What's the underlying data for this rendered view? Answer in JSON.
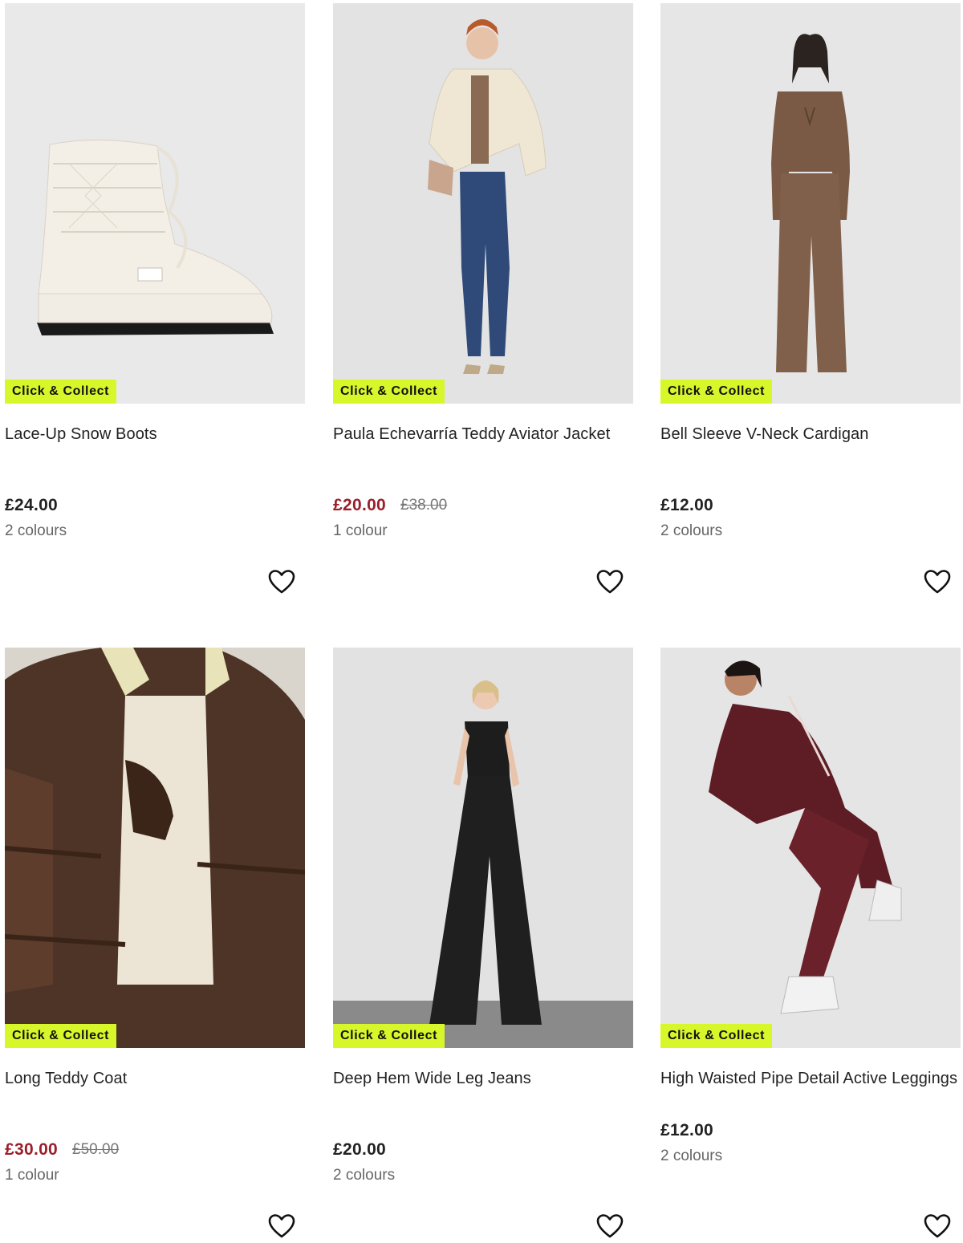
{
  "products": [
    {
      "title": "Lace-Up Snow Boots",
      "badge": "Click & Collect",
      "price": "£24.00",
      "was_price": "",
      "colours": "2 colours"
    },
    {
      "title": "Paula Echevarría Teddy Aviator Jacket",
      "badge": "Click & Collect",
      "price": "£20.00",
      "was_price": "£38.00",
      "colours": "1 colour"
    },
    {
      "title": "Bell Sleeve V-Neck Cardigan",
      "badge": "Click & Collect",
      "price": "£12.00",
      "was_price": "",
      "colours": "2 colours"
    },
    {
      "title": "Long Teddy Coat",
      "badge": "Click & Collect",
      "price": "£30.00",
      "was_price": "£50.00",
      "colours": "1 colour"
    },
    {
      "title": "Deep Hem Wide Leg Jeans",
      "badge": "Click & Collect",
      "price": "£20.00",
      "was_price": "",
      "colours": "2 colours"
    },
    {
      "title": "High Waisted Pipe Detail Active Leggings",
      "badge": "Click & Collect",
      "price": "£12.00",
      "was_price": "",
      "colours": "2 colours"
    }
  ],
  "icons": {
    "favourite": "heart-outline-icon"
  },
  "colors": {
    "badge_bg": "#d7f72a",
    "sale_price": "#9b1f2b",
    "text": "#222222",
    "muted": "#666666"
  }
}
